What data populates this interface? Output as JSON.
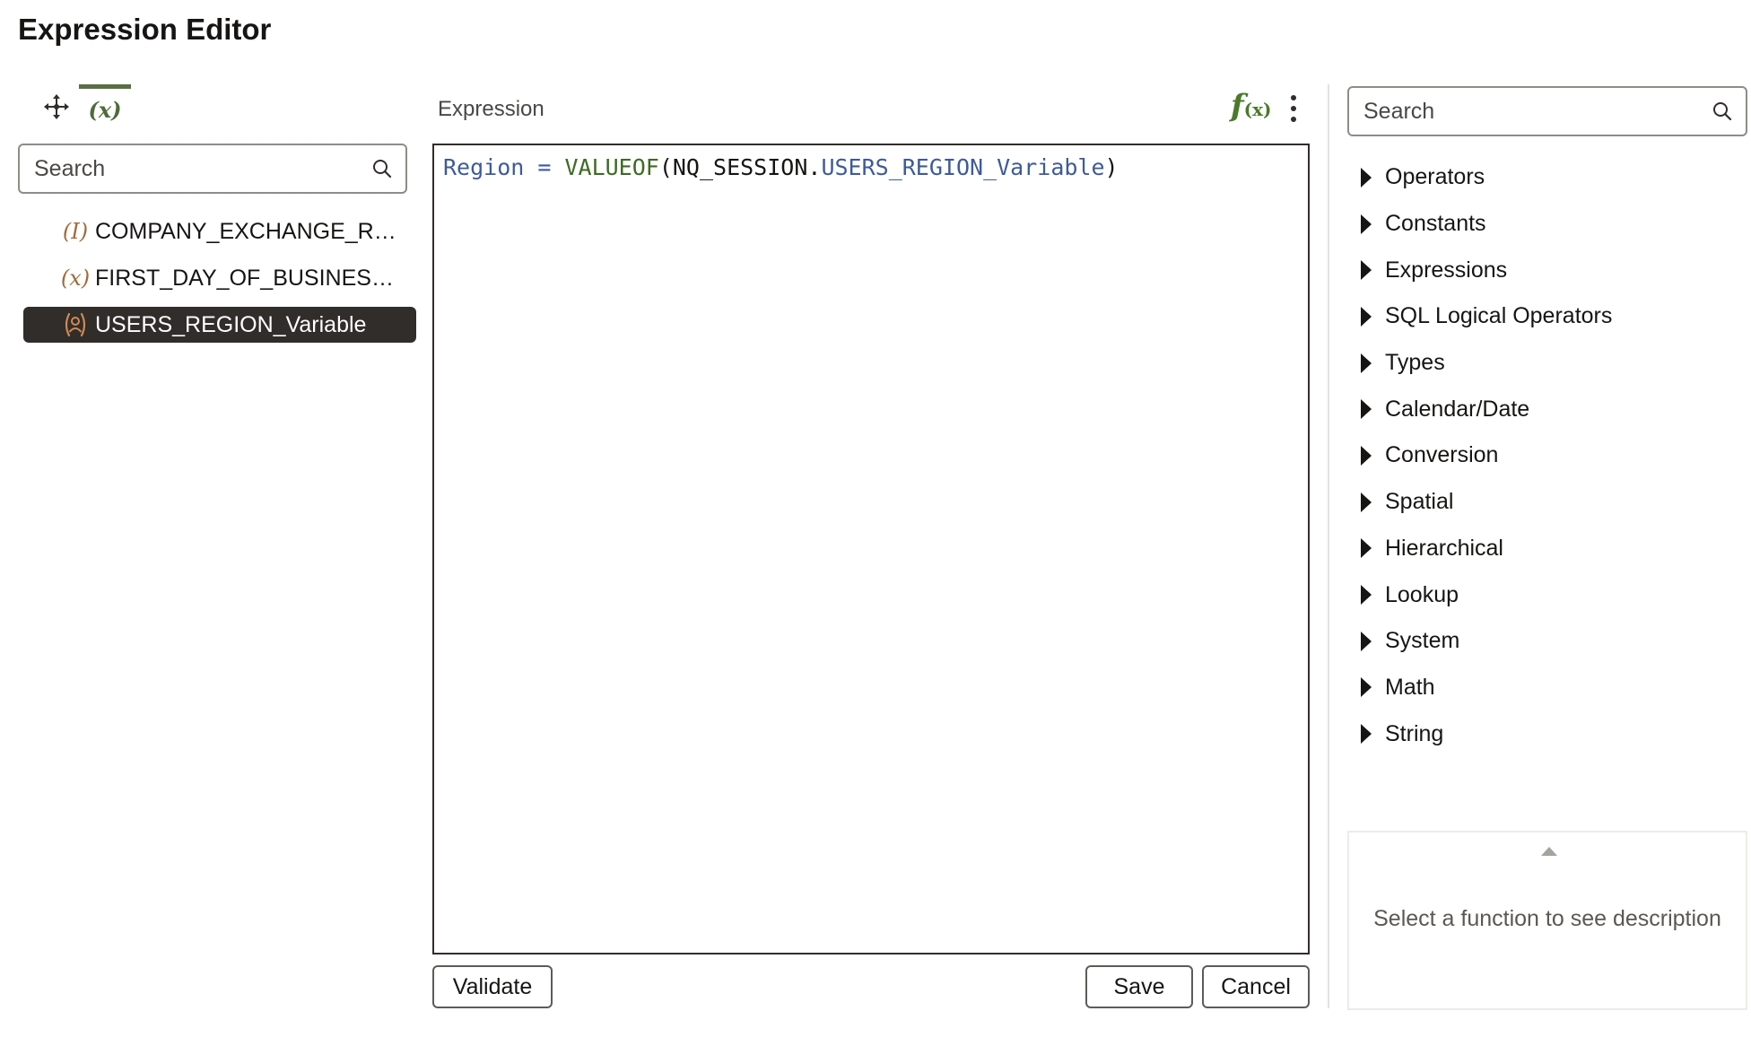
{
  "dialog": {
    "title": "Expression Editor"
  },
  "left_panel": {
    "tabs": [
      {
        "icon": "move-arrows-icon",
        "active": false
      },
      {
        "icon": "variable-icon",
        "glyph": "(x)",
        "active": true
      }
    ],
    "search": {
      "placeholder": "Search",
      "value": ""
    },
    "variables": [
      {
        "glyph": "(I)",
        "icon": "integer-variable-icon",
        "label": "COMPANY_EXCHANGE_RA...",
        "selected": false
      },
      {
        "glyph": "(x)",
        "icon": "variable-icon",
        "label": "FIRST_DAY_OF_BUSINESS_...",
        "selected": false
      },
      {
        "glyph": "",
        "icon": "session-variable-icon",
        "label": "USERS_REGION_Variable",
        "selected": true
      }
    ]
  },
  "center_panel": {
    "label": "Expression",
    "fx_glyph_f": "f",
    "fx_glyph_x": "(x)",
    "expression_tokens": [
      {
        "text": "Region",
        "kind": "field"
      },
      {
        "text": " = ",
        "kind": "op"
      },
      {
        "text": "VALUEOF",
        "kind": "fn"
      },
      {
        "text": "(NQ_SESSION.",
        "kind": "plain"
      },
      {
        "text": "USERS_REGION_Variable",
        "kind": "var"
      },
      {
        "text": ")",
        "kind": "plain"
      }
    ],
    "buttons": {
      "validate": "Validate",
      "save": "Save",
      "cancel": "Cancel"
    }
  },
  "right_panel": {
    "search": {
      "placeholder": "Search",
      "value": ""
    },
    "categories": [
      "Operators",
      "Constants",
      "Expressions",
      "SQL Logical Operators",
      "Types",
      "Calendar/Date",
      "Conversion",
      "Spatial",
      "Hierarchical",
      "Lookup",
      "System",
      "Math",
      "String"
    ],
    "description_placeholder": "Select a function to see description"
  },
  "colors": {
    "accent_green": "#4f6b3a",
    "selected_bg": "#312d2a",
    "variable_icon": "#a3693a",
    "token_blue": "#3e5b99",
    "token_green": "#3d6b22"
  }
}
